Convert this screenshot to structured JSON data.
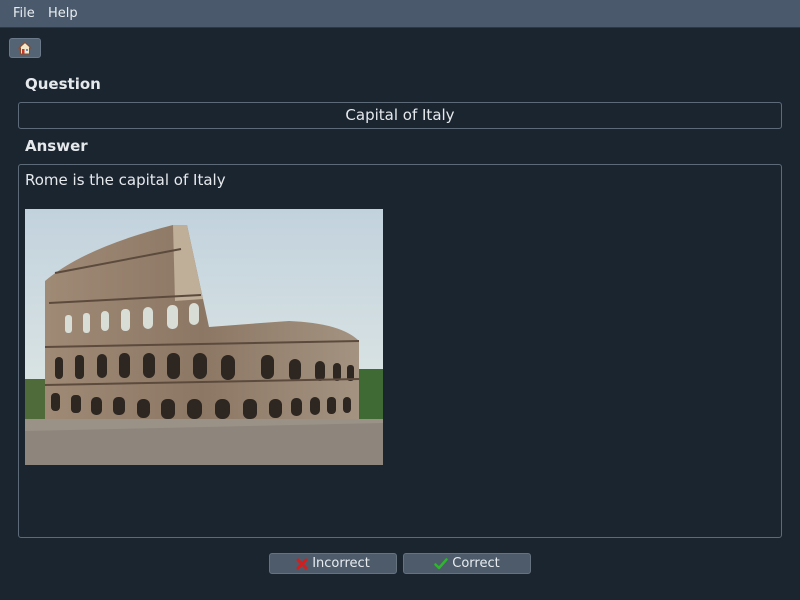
{
  "menu": {
    "file": "File",
    "help": "Help"
  },
  "toolbar": {
    "home_icon": "home-icon"
  },
  "question": {
    "label": "Question",
    "value": "Capital of Italy"
  },
  "answer": {
    "label": "Answer",
    "text": "Rome is the capital of Italy",
    "image_subject": "colosseum-photo"
  },
  "buttons": {
    "incorrect_label": "Incorrect",
    "incorrect_icon": "x-icon",
    "correct_label": "Correct",
    "correct_icon": "check-icon"
  },
  "colors": {
    "background": "#1b2530",
    "menubar": "#4a5a6c",
    "incorrect": "#d11f1f",
    "correct": "#2fb52f"
  }
}
